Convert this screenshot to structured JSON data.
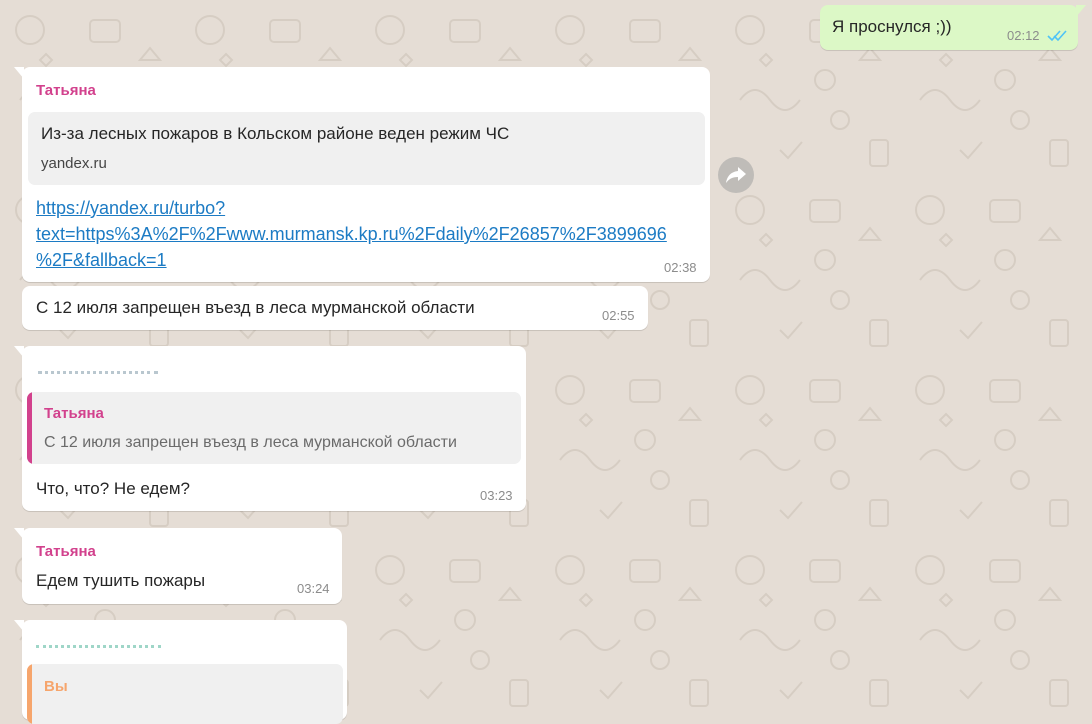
{
  "colors": {
    "chat_background": "#e5ddd5",
    "incoming_bubble": "#ffffff",
    "outgoing_bubble": "#dcf8c6",
    "sender_name": "#d2418d",
    "link": "#1c7bc4",
    "read_ticks": "#4fc3f7",
    "quote_you": "#f6a56c"
  },
  "messages": [
    {
      "direction": "outgoing",
      "text": "Я проснулся ;))",
      "time": "02:12",
      "status_icon": "double-check-read-icon"
    },
    {
      "direction": "incoming",
      "sender": "Татьяна",
      "preview_title": "Из-за лесных пожаров в Кольском районе веден режим ЧС",
      "preview_domain": "yandex.ru",
      "link_lines": [
        "https://yandex.ru/turbo?",
        "text=https%3A%2F%2Fwww.murmansk.kp.ru%2Fdaily%2F26857%2F3899696",
        "%2F&fallback=1"
      ],
      "time": "02:38",
      "action_icon": "forward-icon"
    },
    {
      "direction": "incoming",
      "text": "С 12 июля запрещен въезд в леса мурманской области",
      "time": "02:55"
    },
    {
      "direction": "incoming",
      "quote_author": "Татьяна",
      "quote_text": "С 12 июля запрещен въезд в леса мурманской области",
      "text": "Что, что? Не едем?",
      "time": "03:23"
    },
    {
      "direction": "incoming",
      "sender": "Татьяна",
      "text": "Едем тушить пожары",
      "time": "03:24"
    },
    {
      "direction": "incoming",
      "quote_author": "Вы"
    }
  ]
}
